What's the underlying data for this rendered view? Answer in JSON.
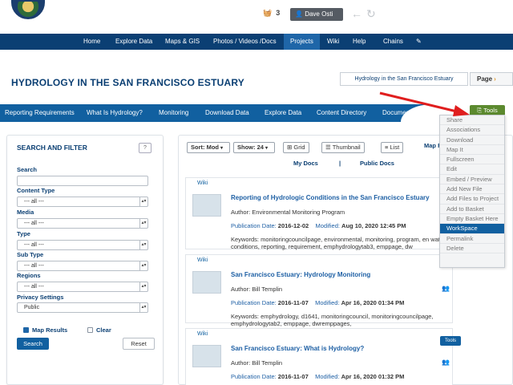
{
  "header": {
    "cart_count": "3",
    "user_label": "Dave Osti"
  },
  "nav": {
    "items": [
      "Home",
      "Explore Data",
      "Maps & GIS",
      "Photos / Videos /Docs",
      "Projects",
      "Wiki",
      "Help",
      "Chains"
    ],
    "active": "Projects"
  },
  "page": {
    "title": "HYDROLOGY IN THE SAN FRANCISCO ESTUARY",
    "breadcrumb": "Hydrology in the San Francisco Estuary",
    "page_button": "Page"
  },
  "tabs": {
    "items": [
      "Reporting Requirements",
      "What Is Hydrology?",
      "Monitoring",
      "Download Data",
      "Explore Data",
      "Content Directory",
      "Documents"
    ],
    "tools_label": "Tools"
  },
  "tools_menu": {
    "items": [
      "Share",
      "Associations",
      "Download",
      "Map It",
      "Fullscreen",
      "Edit",
      "Embed / Preview",
      "Add New File",
      "Add Files to Project",
      "Add to Basket",
      "Empty Basket Here",
      "WorkSpace",
      "Permalink",
      "Delete"
    ],
    "highlighted": "WorkSpace"
  },
  "sidebar": {
    "heading": "SEARCH AND FILTER",
    "search_label": "Search",
    "content_type_label": "Content Type",
    "content_type_value": "--- all ---",
    "media_label": "Media",
    "media_value": "--- all ---",
    "type_label": "Type",
    "type_value": "--- all ---",
    "subtype_label": "Sub Type",
    "subtype_value": "--- all ---",
    "regions_label": "Regions",
    "regions_value": "--- all ---",
    "privacy_label": "Privacy Settings",
    "privacy_value": "Public",
    "map_results_label": "Map Results",
    "clear_label": "Clear",
    "search_button": "Search",
    "reset_button": "Reset"
  },
  "controls": {
    "sort": "Sort: Mod",
    "show": "Show: 24",
    "grid": "Grid",
    "thumbnail": "Thumbnail",
    "list": "List",
    "map_results": "Map R",
    "my_docs": "My Docs",
    "separator": "|",
    "public_docs": "Public Docs"
  },
  "results": [
    {
      "type": "Wiki",
      "title": "Reporting of Hydrologic Conditions in the San Francisco Estuary",
      "author": "Author: Environmental Monitoring Program",
      "pub_label": "Publication Date:",
      "pub_date": "2016-12-02",
      "mod_label": "Modified:",
      "mod_date": "Aug 10, 2020 12:45 PM",
      "keywords": "Keywords: monitoringcouncilpage, environmental, monitoring, program, en water, conditions, reporting, requirement, emphydrologytab3, emppage, dw"
    },
    {
      "type": "Wiki",
      "title": "San Francisco Estuary: Hydrology Monitoring",
      "author": "Author: Bill Templin",
      "pub_label": "Publication Date:",
      "pub_date": "2016-11-07",
      "mod_label": "Modified:",
      "mod_date": "Apr 16, 2020 01:34 PM",
      "keywords": "Keywords: emphydrology, d1641, monitoringcouncil, monitoringcouncilpage, emphydrologytab2, emppage, dwremppages,"
    },
    {
      "type": "Wiki",
      "title": "San Francisco Estuary: What is Hydrology?",
      "author": "Author: Bill Templin",
      "pub_label": "Publication Date:",
      "pub_date": "2016-11-07",
      "mod_label": "Modified:",
      "mod_date": "Apr 16, 2020 01:32 PM",
      "keywords": ""
    }
  ],
  "result_tools_label": "Tools",
  "colors": {
    "nav_blue": "#0b3f73",
    "tab_blue": "#1160a0",
    "tools_green": "#5c8a2f",
    "arrow_red": "#e01e1e"
  }
}
